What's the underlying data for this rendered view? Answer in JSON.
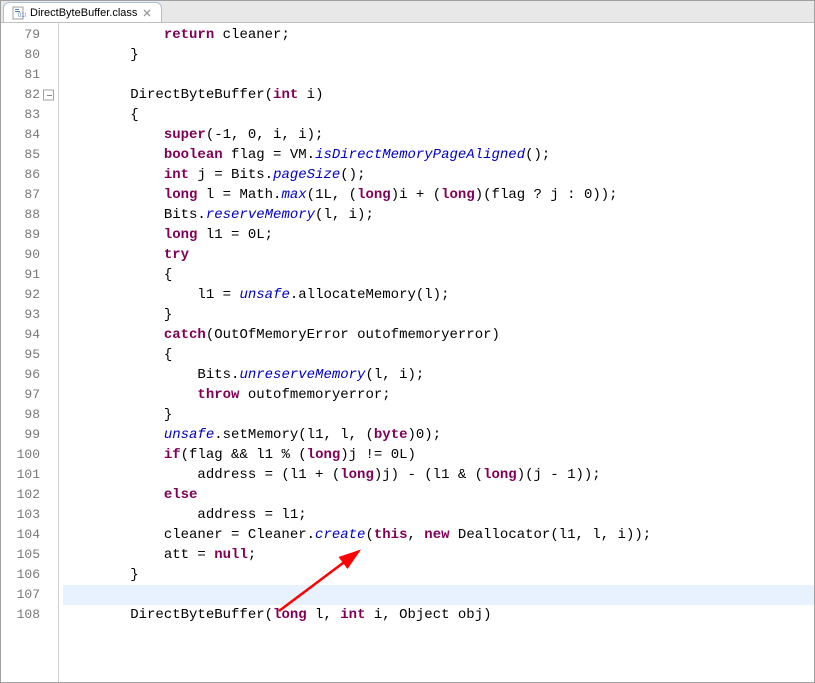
{
  "tab": {
    "title": "DirectByteBuffer.class",
    "icon": "class-file-icon",
    "close": "close-icon"
  },
  "gutter": {
    "start": 79,
    "end": 108,
    "fold_lines": [
      82
    ]
  },
  "code": {
    "lines": [
      {
        "n": 79,
        "t": "            return cleaner;",
        "tokens": [
          {
            "s": "            "
          },
          {
            "s": "return",
            "c": "kw"
          },
          {
            "s": " cleaner;"
          }
        ]
      },
      {
        "n": 80,
        "t": "        }"
      },
      {
        "n": 81,
        "t": ""
      },
      {
        "n": 82,
        "t": "        DirectByteBuffer(int i)",
        "tokens": [
          {
            "s": "        DirectByteBuffer("
          },
          {
            "s": "int",
            "c": "kw"
          },
          {
            "s": " i)"
          }
        ]
      },
      {
        "n": 83,
        "t": "        {"
      },
      {
        "n": 84,
        "t": "            super(-1, 0, i, i);",
        "tokens": [
          {
            "s": "            "
          },
          {
            "s": "super",
            "c": "kw"
          },
          {
            "s": "(-1, 0, i, i);"
          }
        ]
      },
      {
        "n": 85,
        "t": "            boolean flag = VM.isDirectMemoryPageAligned();",
        "tokens": [
          {
            "s": "            "
          },
          {
            "s": "boolean",
            "c": "kw"
          },
          {
            "s": " flag = VM."
          },
          {
            "s": "isDirectMemoryPageAligned",
            "c": "st"
          },
          {
            "s": "();"
          }
        ]
      },
      {
        "n": 86,
        "t": "            int j = Bits.pageSize();",
        "tokens": [
          {
            "s": "            "
          },
          {
            "s": "int",
            "c": "kw"
          },
          {
            "s": " j = Bits."
          },
          {
            "s": "pageSize",
            "c": "st"
          },
          {
            "s": "();"
          }
        ]
      },
      {
        "n": 87,
        "t": "            long l = Math.max(1L, (long)i + (long)(flag ? j : 0));",
        "tokens": [
          {
            "s": "            "
          },
          {
            "s": "long",
            "c": "kw"
          },
          {
            "s": " l = Math."
          },
          {
            "s": "max",
            "c": "st"
          },
          {
            "s": "(1L, ("
          },
          {
            "s": "long",
            "c": "kw"
          },
          {
            "s": ")i + ("
          },
          {
            "s": "long",
            "c": "kw"
          },
          {
            "s": ")(flag ? j : 0));"
          }
        ]
      },
      {
        "n": 88,
        "t": "            Bits.reserveMemory(l, i);",
        "tokens": [
          {
            "s": "            Bits."
          },
          {
            "s": "reserveMemory",
            "c": "st"
          },
          {
            "s": "(l, i);"
          }
        ]
      },
      {
        "n": 89,
        "t": "            long l1 = 0L;",
        "tokens": [
          {
            "s": "            "
          },
          {
            "s": "long",
            "c": "kw"
          },
          {
            "s": " l1 = 0L;"
          }
        ]
      },
      {
        "n": 90,
        "t": "            try",
        "tokens": [
          {
            "s": "            "
          },
          {
            "s": "try",
            "c": "kw"
          }
        ]
      },
      {
        "n": 91,
        "t": "            {"
      },
      {
        "n": 92,
        "t": "                l1 = unsafe.allocateMemory(l);",
        "tokens": [
          {
            "s": "                l1 = "
          },
          {
            "s": "unsafe",
            "c": "st"
          },
          {
            "s": ".allocateMemory(l);"
          }
        ]
      },
      {
        "n": 93,
        "t": "            }"
      },
      {
        "n": 94,
        "t": "            catch(OutOfMemoryError outofmemoryerror)",
        "tokens": [
          {
            "s": "            "
          },
          {
            "s": "catch",
            "c": "kw"
          },
          {
            "s": "(OutOfMemoryError outofmemoryerror)"
          }
        ]
      },
      {
        "n": 95,
        "t": "            {"
      },
      {
        "n": 96,
        "t": "                Bits.unreserveMemory(l, i);",
        "tokens": [
          {
            "s": "                Bits."
          },
          {
            "s": "unreserveMemory",
            "c": "st"
          },
          {
            "s": "(l, i);"
          }
        ]
      },
      {
        "n": 97,
        "t": "                throw outofmemoryerror;",
        "tokens": [
          {
            "s": "                "
          },
          {
            "s": "throw",
            "c": "kw"
          },
          {
            "s": " outofmemoryerror;"
          }
        ]
      },
      {
        "n": 98,
        "t": "            }"
      },
      {
        "n": 99,
        "t": "            unsafe.setMemory(l1, l, (byte)0);",
        "tokens": [
          {
            "s": "            "
          },
          {
            "s": "unsafe",
            "c": "st"
          },
          {
            "s": ".setMemory(l1, l, ("
          },
          {
            "s": "byte",
            "c": "kw"
          },
          {
            "s": ")0);"
          }
        ]
      },
      {
        "n": 100,
        "t": "            if(flag && l1 % (long)j != 0L)",
        "tokens": [
          {
            "s": "            "
          },
          {
            "s": "if",
            "c": "kw"
          },
          {
            "s": "(flag && l1 % ("
          },
          {
            "s": "long",
            "c": "kw"
          },
          {
            "s": ")j != 0L)"
          }
        ]
      },
      {
        "n": 101,
        "t": "                address = (l1 + (long)j) - (l1 & (long)(j - 1));",
        "tokens": [
          {
            "s": "                address = (l1 + ("
          },
          {
            "s": "long",
            "c": "kw"
          },
          {
            "s": ")j) - (l1 & ("
          },
          {
            "s": "long",
            "c": "kw"
          },
          {
            "s": ")(j - 1));"
          }
        ]
      },
      {
        "n": 102,
        "t": "            else",
        "tokens": [
          {
            "s": "            "
          },
          {
            "s": "else",
            "c": "kw"
          }
        ]
      },
      {
        "n": 103,
        "t": "                address = l1;"
      },
      {
        "n": 104,
        "t": "            cleaner = Cleaner.create(this, new Deallocator(l1, l, i));",
        "tokens": [
          {
            "s": "            cleaner = Cleaner."
          },
          {
            "s": "create",
            "c": "st"
          },
          {
            "s": "("
          },
          {
            "s": "this",
            "c": "kw"
          },
          {
            "s": ", "
          },
          {
            "s": "new",
            "c": "kw"
          },
          {
            "s": " Deallocator(l1, l, i));"
          }
        ]
      },
      {
        "n": 105,
        "t": "            att = null;",
        "tokens": [
          {
            "s": "            att = "
          },
          {
            "s": "null",
            "c": "kw"
          },
          {
            "s": ";"
          }
        ]
      },
      {
        "n": 106,
        "t": "        }"
      },
      {
        "n": 107,
        "t": "",
        "hl": true
      },
      {
        "n": 108,
        "t": "        DirectByteBuffer(long l, int i, Object obj)",
        "tokens": [
          {
            "s": "        DirectByteBuffer("
          },
          {
            "s": "long",
            "c": "kw"
          },
          {
            "s": " l, "
          },
          {
            "s": "int",
            "c": "kw"
          },
          {
            "s": " i, Object obj)"
          }
        ]
      }
    ]
  },
  "annotation": {
    "type": "arrow",
    "color": "#ff0000"
  }
}
